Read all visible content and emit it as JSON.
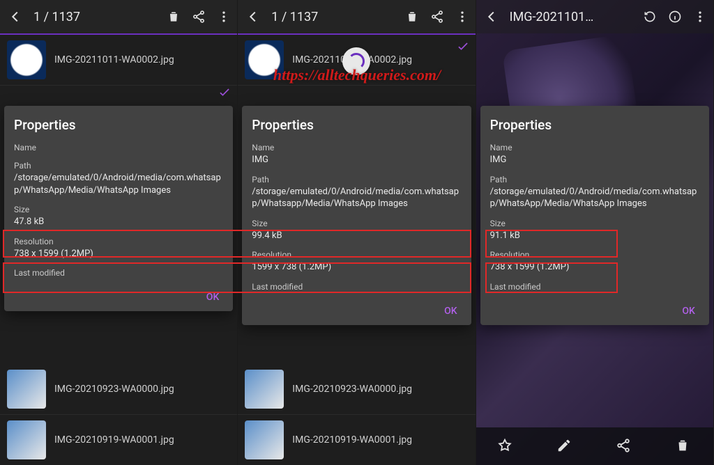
{
  "watermark": "https://alltechqueries.com/",
  "screens": [
    {
      "header_title": "1 / 1137",
      "file1": "IMG-20211011-WA0002.jpg",
      "file2": "IMG-20210923-WA0000.jpg",
      "file3": "IMG-20210919-WA0001.jpg",
      "dialog": {
        "title": "Properties",
        "name_label": "Name",
        "name_value": "",
        "path_label": "Path",
        "path_value": "/storage/emulated/0/Android/media/com.whatsapp/WhatsApp/Media/WhatsApp Images",
        "size_label": "Size",
        "size_value": "47.8 kB",
        "res_label": "Resolution",
        "res_value": "738 x 1599 (1.2MP)",
        "mod_label": "Last modified",
        "ok": "OK"
      }
    },
    {
      "header_title": "1 / 1137",
      "file1": "IMG-20211011-WA0002.jpg",
      "file2": "IMG-20210923-WA0000.jpg",
      "file3": "IMG-20210919-WA0001.jpg",
      "dialog": {
        "title": "Properties",
        "name_label": "Name",
        "name_value": "IMG",
        "path_label": "Path",
        "path_value": "/storage/emulated/0/Android/media/com.whatsapp/Whatsapp/Media/WhatsApp Images",
        "size_label": "Size",
        "size_value": "99.4 kB",
        "res_label": "Resolution",
        "res_value": "1599 x 738 (1.2MP)",
        "mod_label": "Last modified",
        "ok": "OK"
      }
    },
    {
      "header_title": "IMG-2021101…",
      "dialog": {
        "title": "Properties",
        "name_label": "Name",
        "name_value": "IMG",
        "path_label": "Path",
        "path_value": "/storage/emulated/0/Android/media/com.whatsapp/WhatsApp/Media/WhatsApp Images",
        "size_label": "Size",
        "size_value": "91.1 kB",
        "res_label": "Resolution",
        "res_value": "738 x 1599 (1.2MP)",
        "mod_label": "Last modified",
        "ok": "OK"
      }
    }
  ]
}
